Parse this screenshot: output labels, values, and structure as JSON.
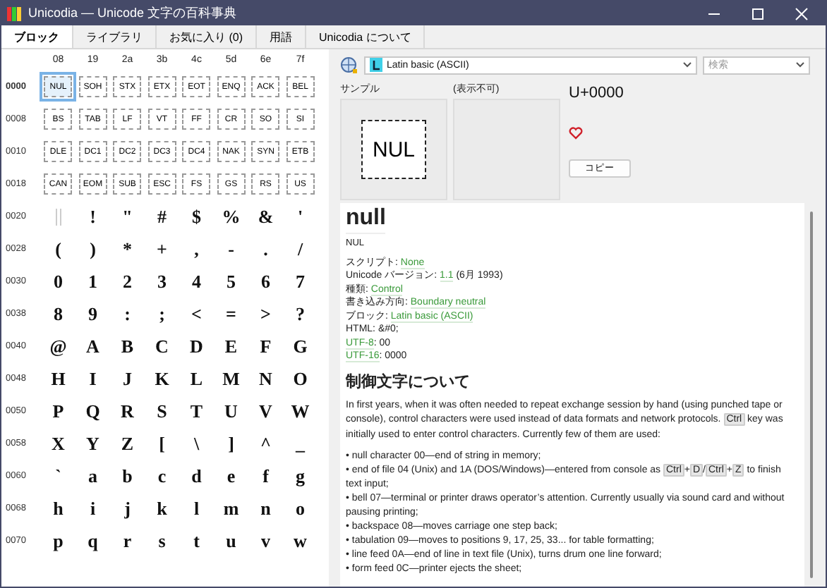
{
  "window": {
    "title": "Unicodia — Unicode 文字の百科事典"
  },
  "tabs": [
    {
      "label": "ブロック",
      "selected": true
    },
    {
      "label": "ライブラリ",
      "selected": false
    },
    {
      "label": "お気に入り (0)",
      "selected": false
    },
    {
      "label": "用語",
      "selected": false
    },
    {
      "label": "Unicodia について",
      "selected": false
    }
  ],
  "grid": {
    "columns": [
      "08",
      "19",
      "2a",
      "3b",
      "4c",
      "5d",
      "6e",
      "7f"
    ],
    "rows": [
      {
        "code": "0000",
        "cells": [
          {
            "ch": "NUL",
            "kind": "control",
            "selected": true
          },
          {
            "ch": "SOH",
            "kind": "control",
            "selected": false
          },
          {
            "ch": "STX",
            "kind": "control",
            "selected": false
          },
          {
            "ch": "ETX",
            "kind": "control",
            "selected": false
          },
          {
            "ch": "EOT",
            "kind": "control",
            "selected": false
          },
          {
            "ch": "ENQ",
            "kind": "control",
            "selected": false
          },
          {
            "ch": "ACK",
            "kind": "control",
            "selected": false
          },
          {
            "ch": "BEL",
            "kind": "control",
            "selected": false
          }
        ]
      },
      {
        "code": "0008",
        "cells": [
          {
            "ch": "BS",
            "kind": "control",
            "selected": false
          },
          {
            "ch": "TAB",
            "kind": "control",
            "selected": false
          },
          {
            "ch": "LF",
            "kind": "control",
            "selected": false
          },
          {
            "ch": "VT",
            "kind": "control",
            "selected": false
          },
          {
            "ch": "FF",
            "kind": "control",
            "selected": false
          },
          {
            "ch": "CR",
            "kind": "control",
            "selected": false
          },
          {
            "ch": "SO",
            "kind": "control",
            "selected": false
          },
          {
            "ch": "SI",
            "kind": "control",
            "selected": false
          }
        ]
      },
      {
        "code": "0010",
        "cells": [
          {
            "ch": "DLE",
            "kind": "control",
            "selected": false
          },
          {
            "ch": "DC1",
            "kind": "control",
            "selected": false
          },
          {
            "ch": "DC2",
            "kind": "control",
            "selected": false
          },
          {
            "ch": "DC3",
            "kind": "control",
            "selected": false
          },
          {
            "ch": "DC4",
            "kind": "control",
            "selected": false
          },
          {
            "ch": "NAK",
            "kind": "control",
            "selected": false
          },
          {
            "ch": "SYN",
            "kind": "control",
            "selected": false
          },
          {
            "ch": "ETB",
            "kind": "control",
            "selected": false
          }
        ]
      },
      {
        "code": "0018",
        "cells": [
          {
            "ch": "CAN",
            "kind": "control",
            "selected": false
          },
          {
            "ch": "EOM",
            "kind": "control",
            "selected": false
          },
          {
            "ch": "SUB",
            "kind": "control",
            "selected": false
          },
          {
            "ch": "ESC",
            "kind": "control",
            "selected": false
          },
          {
            "ch": "FS",
            "kind": "control",
            "selected": false
          },
          {
            "ch": "GS",
            "kind": "control",
            "selected": false
          },
          {
            "ch": "RS",
            "kind": "control",
            "selected": false
          },
          {
            "ch": "US",
            "kind": "control",
            "selected": false
          }
        ]
      },
      {
        "code": "0020",
        "cells": [
          {
            "kind": "space",
            "selected": false
          },
          {
            "ch": "!",
            "kind": "glyph",
            "selected": false
          },
          {
            "ch": "\"",
            "kind": "glyph",
            "selected": false
          },
          {
            "ch": "#",
            "kind": "glyph",
            "selected": false
          },
          {
            "ch": "$",
            "kind": "glyph",
            "selected": false
          },
          {
            "ch": "%",
            "kind": "glyph",
            "selected": false
          },
          {
            "ch": "&",
            "kind": "glyph",
            "selected": false
          },
          {
            "ch": "'",
            "kind": "glyph",
            "selected": false
          }
        ]
      },
      {
        "code": "0028",
        "cells": [
          {
            "ch": "(",
            "kind": "glyph",
            "selected": false
          },
          {
            "ch": ")",
            "kind": "glyph",
            "selected": false
          },
          {
            "ch": "*",
            "kind": "glyph",
            "selected": false
          },
          {
            "ch": "+",
            "kind": "glyph",
            "selected": false
          },
          {
            "ch": ",",
            "kind": "glyph",
            "selected": false
          },
          {
            "ch": "-",
            "kind": "glyph",
            "selected": false
          },
          {
            "ch": ".",
            "kind": "glyph",
            "selected": false
          },
          {
            "ch": "/",
            "kind": "glyph",
            "selected": false
          }
        ]
      },
      {
        "code": "0030",
        "cells": [
          {
            "ch": "0",
            "kind": "glyph",
            "selected": false
          },
          {
            "ch": "1",
            "kind": "glyph",
            "selected": false
          },
          {
            "ch": "2",
            "kind": "glyph",
            "selected": false
          },
          {
            "ch": "3",
            "kind": "glyph",
            "selected": false
          },
          {
            "ch": "4",
            "kind": "glyph",
            "selected": false
          },
          {
            "ch": "5",
            "kind": "glyph",
            "selected": false
          },
          {
            "ch": "6",
            "kind": "glyph",
            "selected": false
          },
          {
            "ch": "7",
            "kind": "glyph",
            "selected": false
          }
        ]
      },
      {
        "code": "0038",
        "cells": [
          {
            "ch": "8",
            "kind": "glyph",
            "selected": false
          },
          {
            "ch": "9",
            "kind": "glyph",
            "selected": false
          },
          {
            "ch": ":",
            "kind": "glyph",
            "selected": false
          },
          {
            "ch": ";",
            "kind": "glyph",
            "selected": false
          },
          {
            "ch": "<",
            "kind": "glyph",
            "selected": false
          },
          {
            "ch": "=",
            "kind": "glyph",
            "selected": false
          },
          {
            "ch": ">",
            "kind": "glyph",
            "selected": false
          },
          {
            "ch": "?",
            "kind": "glyph",
            "selected": false
          }
        ]
      },
      {
        "code": "0040",
        "cells": [
          {
            "ch": "@",
            "kind": "glyph",
            "selected": false
          },
          {
            "ch": "A",
            "kind": "glyph",
            "selected": false
          },
          {
            "ch": "B",
            "kind": "glyph",
            "selected": false
          },
          {
            "ch": "C",
            "kind": "glyph",
            "selected": false
          },
          {
            "ch": "D",
            "kind": "glyph",
            "selected": false
          },
          {
            "ch": "E",
            "kind": "glyph",
            "selected": false
          },
          {
            "ch": "F",
            "kind": "glyph",
            "selected": false
          },
          {
            "ch": "G",
            "kind": "glyph",
            "selected": false
          }
        ]
      },
      {
        "code": "0048",
        "cells": [
          {
            "ch": "H",
            "kind": "glyph",
            "selected": false
          },
          {
            "ch": "I",
            "kind": "glyph",
            "selected": false
          },
          {
            "ch": "J",
            "kind": "glyph",
            "selected": false
          },
          {
            "ch": "K",
            "kind": "glyph",
            "selected": false
          },
          {
            "ch": "L",
            "kind": "glyph",
            "selected": false
          },
          {
            "ch": "M",
            "kind": "glyph",
            "selected": false
          },
          {
            "ch": "N",
            "kind": "glyph",
            "selected": false
          },
          {
            "ch": "O",
            "kind": "glyph",
            "selected": false
          }
        ]
      },
      {
        "code": "0050",
        "cells": [
          {
            "ch": "P",
            "kind": "glyph",
            "selected": false
          },
          {
            "ch": "Q",
            "kind": "glyph",
            "selected": false
          },
          {
            "ch": "R",
            "kind": "glyph",
            "selected": false
          },
          {
            "ch": "S",
            "kind": "glyph",
            "selected": false
          },
          {
            "ch": "T",
            "kind": "glyph",
            "selected": false
          },
          {
            "ch": "U",
            "kind": "glyph",
            "selected": false
          },
          {
            "ch": "V",
            "kind": "glyph",
            "selected": false
          },
          {
            "ch": "W",
            "kind": "glyph",
            "selected": false
          }
        ]
      },
      {
        "code": "0058",
        "cells": [
          {
            "ch": "X",
            "kind": "glyph",
            "selected": false
          },
          {
            "ch": "Y",
            "kind": "glyph",
            "selected": false
          },
          {
            "ch": "Z",
            "kind": "glyph",
            "selected": false
          },
          {
            "ch": "[",
            "kind": "glyph",
            "selected": false
          },
          {
            "ch": "\\",
            "kind": "glyph",
            "selected": false
          },
          {
            "ch": "]",
            "kind": "glyph",
            "selected": false
          },
          {
            "ch": "^",
            "kind": "glyph",
            "selected": false
          },
          {
            "ch": "_",
            "kind": "glyph",
            "selected": false
          }
        ]
      },
      {
        "code": "0060",
        "cells": [
          {
            "ch": "`",
            "kind": "glyph",
            "selected": false
          },
          {
            "ch": "a",
            "kind": "glyph",
            "selected": false
          },
          {
            "ch": "b",
            "kind": "glyph",
            "selected": false
          },
          {
            "ch": "c",
            "kind": "glyph",
            "selected": false
          },
          {
            "ch": "d",
            "kind": "glyph",
            "selected": false
          },
          {
            "ch": "e",
            "kind": "glyph",
            "selected": false
          },
          {
            "ch": "f",
            "kind": "glyph",
            "selected": false
          },
          {
            "ch": "g",
            "kind": "glyph",
            "selected": false
          }
        ]
      },
      {
        "code": "0068",
        "cells": [
          {
            "ch": "h",
            "kind": "glyph",
            "selected": false
          },
          {
            "ch": "i",
            "kind": "glyph",
            "selected": false
          },
          {
            "ch": "j",
            "kind": "glyph",
            "selected": false
          },
          {
            "ch": "k",
            "kind": "glyph",
            "selected": false
          },
          {
            "ch": "l",
            "kind": "glyph",
            "selected": false
          },
          {
            "ch": "m",
            "kind": "glyph",
            "selected": false
          },
          {
            "ch": "n",
            "kind": "glyph",
            "selected": false
          },
          {
            "ch": "o",
            "kind": "glyph",
            "selected": false
          }
        ]
      },
      {
        "code": "0070",
        "cells": [
          {
            "ch": "p",
            "kind": "glyph",
            "selected": false
          },
          {
            "ch": "q",
            "kind": "glyph",
            "selected": false
          },
          {
            "ch": "r",
            "kind": "glyph",
            "selected": false
          },
          {
            "ch": "s",
            "kind": "glyph",
            "selected": false
          },
          {
            "ch": "t",
            "kind": "glyph",
            "selected": false
          },
          {
            "ch": "u",
            "kind": "glyph",
            "selected": false
          },
          {
            "ch": "v",
            "kind": "glyph",
            "selected": false
          },
          {
            "ch": "w",
            "kind": "glyph",
            "selected": false
          }
        ]
      }
    ]
  },
  "block_select": {
    "value": "Latin basic (ASCII)"
  },
  "search": {
    "placeholder": "検索"
  },
  "sample": {
    "label": "サンプル",
    "glyph": "NUL"
  },
  "alt_sample": {
    "label": "(表示不可)"
  },
  "code_point": "U+0000",
  "copy_button": "コピー",
  "article": {
    "title": "null",
    "subtitle": "NUL",
    "info": [
      [
        {
          "text": "スクリプト: ",
          "kind": "text"
        },
        {
          "text": "None",
          "kind": "link"
        }
      ],
      [
        {
          "text": "Unicode バージョン: ",
          "kind": "text"
        },
        {
          "text": "1.1",
          "kind": "link"
        },
        {
          "text": " (6月 1993)",
          "kind": "text"
        }
      ],
      [
        {
          "text": "種類: ",
          "kind": "text"
        },
        {
          "text": "Control",
          "kind": "link"
        }
      ],
      [
        {
          "text": "書き込み方向: ",
          "kind": "text"
        },
        {
          "text": "Boundary neutral",
          "kind": "link"
        }
      ],
      [
        {
          "text": "ブロック: ",
          "kind": "text"
        },
        {
          "text": "Latin basic (ASCII)",
          "kind": "link"
        }
      ],
      [
        {
          "text": "HTML: &#0;",
          "kind": "text"
        }
      ],
      [
        {
          "text": "UTF-8",
          "kind": "link"
        },
        {
          "text": ": 00",
          "kind": "text"
        }
      ],
      [
        {
          "text": "UTF-16",
          "kind": "link"
        },
        {
          "text": ": 0000",
          "kind": "text"
        }
      ]
    ],
    "heading": "制御文字について",
    "paragraphs": [
      [
        {
          "text": "In first years, when it was often needed to repeat exchange session by hand (using punched tape or console), control characters were used instead of data formats and network protocols. ",
          "kind": "text"
        },
        {
          "text": "Ctrl",
          "kind": "key"
        },
        {
          "text": " key was initially used to enter control characters. Currently few of them are used:",
          "kind": "text"
        }
      ]
    ],
    "bullets": [
      [
        {
          "text": "• null character 00—end of string in memory;",
          "kind": "text"
        }
      ],
      [
        {
          "text": "• end of file 04 (Unix) and 1A (DOS/Windows)—entered from console as ",
          "kind": "text"
        },
        {
          "text": "Ctrl",
          "kind": "key"
        },
        {
          "text": "+",
          "kind": "text"
        },
        {
          "text": "D",
          "kind": "key"
        },
        {
          "text": "/",
          "kind": "text"
        },
        {
          "text": "Ctrl",
          "kind": "key"
        },
        {
          "text": "+",
          "kind": "text"
        },
        {
          "text": "Z",
          "kind": "key"
        },
        {
          "text": " to finish text input;",
          "kind": "text"
        }
      ],
      [
        {
          "text": "• bell 07—terminal or printer draws operator’s attention. Currently usually via sound card and without pausing printing;",
          "kind": "text"
        }
      ],
      [
        {
          "text": "• backspace 08—moves carriage one step back;",
          "kind": "text"
        }
      ],
      [
        {
          "text": "• tabulation 09—moves to positions 9, 17, 25, 33... for table formatting;",
          "kind": "text"
        }
      ],
      [
        {
          "text": "• line feed 0A—end of line in text file (Unix), turns drum one line forward;",
          "kind": "text"
        }
      ],
      [
        {
          "text": "• form feed 0C—printer ejects the sheet;",
          "kind": "text"
        }
      ]
    ]
  }
}
